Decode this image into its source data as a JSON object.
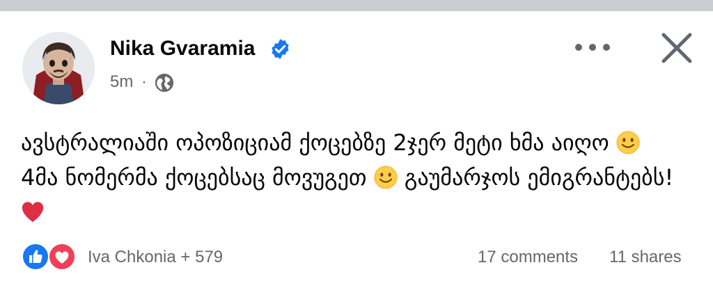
{
  "post": {
    "author": "Nika Gvaramia",
    "verified": true,
    "time": "5m",
    "separator": "·",
    "privacy_icon": "globe-icon",
    "text_part1": "ავსტრალიაში ოპოზიციამ ქოცებზე 2ჯერ მეტი ხმა აიღო ",
    "text_part2": " 4მა ნომერმა ქოცებსაც მოვუგეთ ",
    "text_part3": " გაუმარჯოს ემიგრანტებს! ",
    "emojis": [
      "slightly-smiling-face",
      "slightly-smiling-face",
      "red-heart"
    ]
  },
  "reactions": {
    "icons": [
      "like-icon",
      "love-icon"
    ],
    "names": "Iva Chkonia + 579"
  },
  "stats": {
    "comments": "17 comments",
    "shares": "11 shares"
  },
  "colors": {
    "brand_blue": "#1877f2",
    "love_red": "#f33e58",
    "secondary_text": "#65676b",
    "verified_blue": "#1877f2"
  }
}
